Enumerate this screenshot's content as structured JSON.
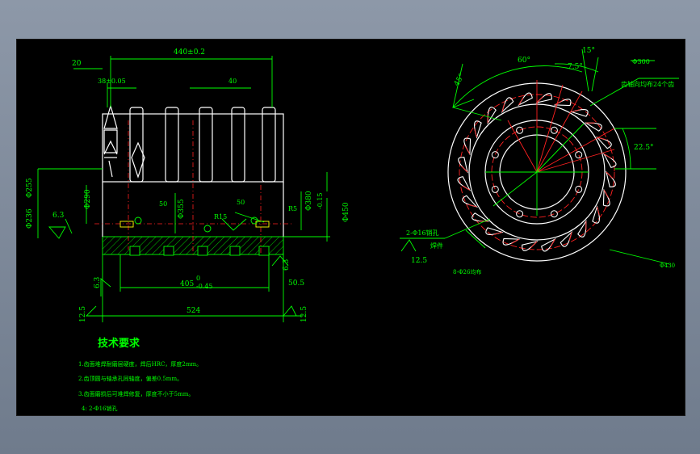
{
  "front_view": {
    "dims": {
      "top_overall": "440±0.2",
      "left_offset": "20",
      "pitch_small": "38±0.05",
      "pitch_40": "40",
      "dia_236": "Φ236",
      "dia_255": "Φ255",
      "dia_290": "Φ290",
      "dia_355": "Φ355",
      "dia_380": "Φ380",
      "dia_450": "Φ450",
      "tol_380": "-0.15",
      "r15": "R15",
      "r5": "R5",
      "width_50a": "50",
      "width_50b": "50",
      "bore_len": "405",
      "bore_tol_top": "0",
      "bore_tol_bot": "-0.45",
      "right_50": "50.5",
      "overall_524": "524",
      "rough_6_3_a": "6.3",
      "rough_6_3_b": "6.3",
      "rough_6_3_c": "6.3",
      "rough_12_5_a": "12.5",
      "rough_12_5_b": "12.5"
    }
  },
  "side_view": {
    "angle_60": "60°",
    "angle_45": "45°",
    "angle_15": "15°",
    "angle_7_5": "7.5°",
    "angle_22_5": "22.5°",
    "label_top_right": "Φ300",
    "label_teeth": "齿轴向均布24个齿",
    "label_holes": "2-Φ16销孔",
    "label_weld": "焊件",
    "rough_12_5": "12.5",
    "label_bottom_left": "8-Φ26均布",
    "label_bottom_right": "Φ430"
  },
  "requirements": {
    "title": "技术要求",
    "items": [
      "1.齿面堆焊耐磨层硬度，焊后HRC，厚度2mm。",
      "2.齿顶圆与轴承孔同轴度，偏差0.5mm。",
      "3.齿面磨损后可堆焊修复，厚度不小于5mm。",
      "4:  2-Φ16销孔"
    ]
  }
}
